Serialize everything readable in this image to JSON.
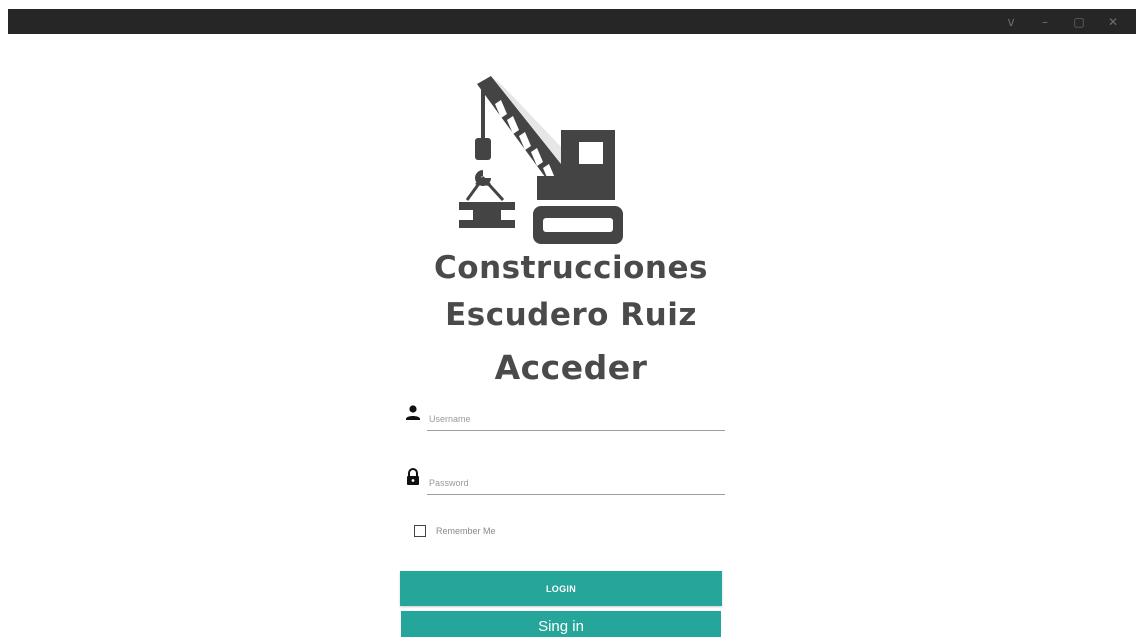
{
  "window": {
    "controls": [
      "v",
      "–",
      "▢",
      "✕"
    ]
  },
  "brand": {
    "line1": "Construcciones",
    "line2": "Escudero Ruiz"
  },
  "form": {
    "heading": "Acceder",
    "username_placeholder": "Username",
    "password_placeholder": "Password",
    "remember_label": "Remember Me",
    "remember_checked": false,
    "login_label": "LOGIN",
    "signin_label": "Sing in"
  },
  "icons": {
    "logo": "crane-icon",
    "username": "person-icon",
    "password": "lock-icon",
    "dropdown": "chevron-down-icon",
    "minimize": "minimize-icon",
    "maximize": "maximize-icon",
    "close": "close-icon"
  },
  "colors": {
    "titlebar": "#262626",
    "accent": "#26a69a",
    "brand_text": "#4a4a4a",
    "logo": "#444444"
  }
}
